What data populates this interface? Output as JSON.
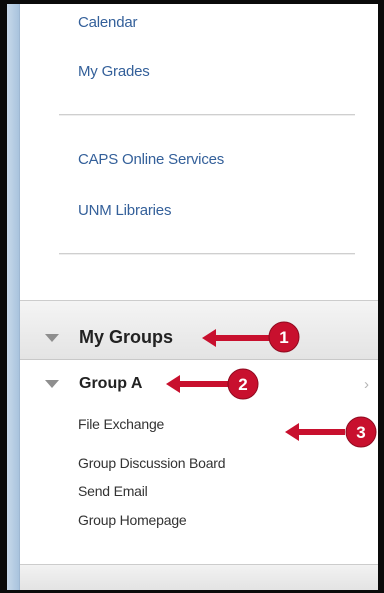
{
  "menu": {
    "links": [
      "Calendar",
      "My Grades",
      "CAPS Online Services",
      "UNM Libraries"
    ]
  },
  "my_groups": {
    "title": "My Groups",
    "group": {
      "name": "Group A",
      "expand_glyph": "›",
      "items": [
        "File Exchange",
        "Group Discussion Board",
        "Send Email",
        "Group Homepage"
      ]
    }
  },
  "callouts": [
    "1",
    "2",
    "3"
  ],
  "colors": {
    "link": "#34609a",
    "callout": "#c8102e",
    "accent": "#a9c3dd"
  }
}
